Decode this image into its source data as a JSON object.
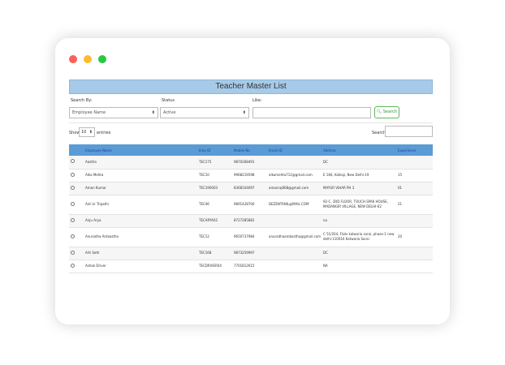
{
  "page": {
    "title": "Teacher Master List"
  },
  "filters": {
    "search_by_label": "Search By:",
    "search_by_value": "Employee Name",
    "status_label": "Status",
    "status_value": "Active",
    "like_label": "Like:",
    "like_value": "",
    "search_button_label": "Search"
  },
  "table_controls": {
    "show_label": "Show",
    "entries_value": "10",
    "entries_label": "entries",
    "search_label": "Search:",
    "search_value": ""
  },
  "table": {
    "columns": [
      "",
      "Employee Name",
      "Emp ID",
      "Mobile No",
      "Email ID",
      "Address",
      "Experience"
    ],
    "rows": [
      {
        "name": "Aastha",
        "emp_id": "TEC175",
        "mobile": "9870268491",
        "email": "",
        "address": "DC",
        "experience": ""
      },
      {
        "name": "Alka Mehta",
        "emp_id": "TEC10",
        "mobile": "9968219598",
        "email": "alkamehta712@gmail.com",
        "address": "E 184, Kalkaji, New Delhi-19",
        "experience": "15"
      },
      {
        "name": "Aman Kumar",
        "emp_id": "TEC190003",
        "mobile": "8368104697",
        "email": "amanraj868@gmail.com",
        "address": "MAYUR VIHAR PH 3",
        "experience": "01"
      },
      {
        "name": "Anil kr Tripathi",
        "emp_id": "TEC46",
        "mobile": "9891428700",
        "email": "DEZENTANIL@MAIL.COM",
        "address": "92-C, 3RD FLOOR, TOUCH SPAK HOUSE, MADANGIR VILLAGE, NEW DELHI-62",
        "experience": "21"
      },
      {
        "name": "Anju Arya",
        "emp_id": "TECARYA02",
        "mobile": "8727285881",
        "email": "",
        "address": "na",
        "experience": ""
      },
      {
        "name": "Anuradha Ambastha",
        "emp_id": "TEC12",
        "mobile": "9650737984",
        "email": "anuradhaambastha@gmail.com",
        "address": "C 51/204, Flats kalwaria sarai, phase-1 new delhi-110016 Katwaria Sarai",
        "experience": "20"
      },
      {
        "name": "Arti Seth",
        "emp_id": "TEC168",
        "mobile": "9873259997",
        "email": "",
        "address": "DC",
        "experience": ""
      },
      {
        "name": "Ashok Driver",
        "emp_id": "TECDRIVER04",
        "mobile": "7701812615",
        "email": "",
        "address": "NA",
        "experience": ""
      }
    ]
  },
  "colors": {
    "title_bar": "#a6cae8",
    "table_header": "#5b9bd5",
    "search_button": "#5cb85c"
  }
}
